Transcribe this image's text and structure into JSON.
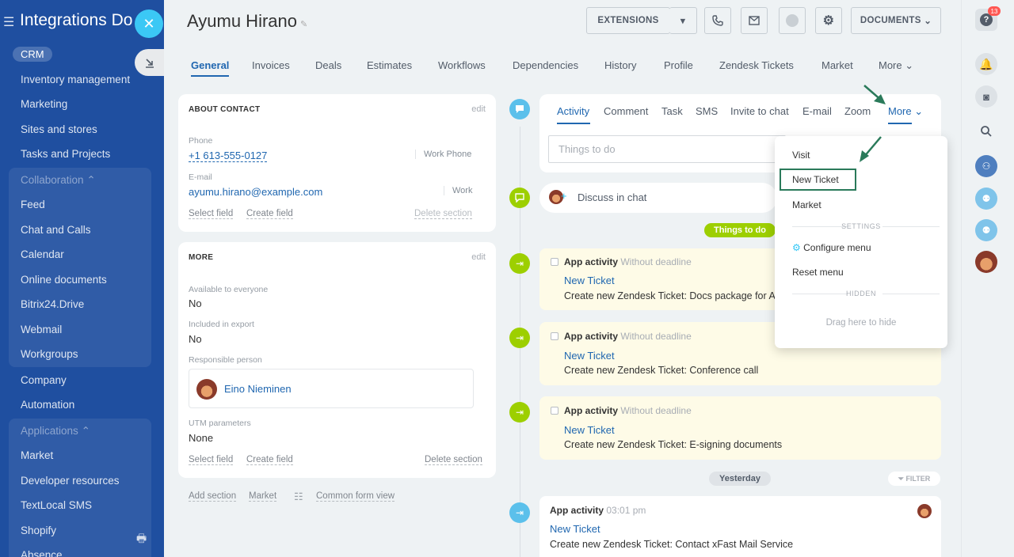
{
  "sidebar": {
    "title": "Integrations Do",
    "crm_label": "CRM",
    "items": [
      "Inventory management",
      "Marketing",
      "Sites and stores",
      "Tasks and Projects"
    ],
    "collaboration_title": "Collaboration",
    "collaboration_items": [
      "Feed",
      "Chat and Calls",
      "Calendar",
      "Online documents",
      "Bitrix24.Drive",
      "Webmail",
      "Workgroups"
    ],
    "mid_items": [
      "Company",
      "Automation"
    ],
    "applications_title": "Applications",
    "applications_items": [
      "Market",
      "Developer resources",
      "TextLocal SMS",
      "Shopify",
      "Absence"
    ],
    "close_icon": "close-icon",
    "collapse_icon": "collapse-icon"
  },
  "header": {
    "contact_name": "Ayumu Hirano",
    "extensions_label": "EXTENSIONS",
    "documents_label": "DOCUMENTS"
  },
  "tabs": [
    "General",
    "Invoices",
    "Deals",
    "Estimates",
    "Workflows",
    "Dependencies",
    "History",
    "Profile",
    "Zendesk Tickets",
    "Market",
    "More"
  ],
  "about_contact": {
    "title": "ABOUT CONTACT",
    "edit": "edit",
    "phone_label": "Phone",
    "phone_value": "+1 613-555-0127",
    "phone_tag": "Work Phone",
    "email_label": "E-mail",
    "email_value": "ayumu.hirano@example.com",
    "email_tag": "Work",
    "select_field": "Select field",
    "create_field": "Create field",
    "delete_section": "Delete section"
  },
  "more_card": {
    "title": "MORE",
    "edit": "edit",
    "available_label": "Available to everyone",
    "available_value": "No",
    "export_label": "Included in export",
    "export_value": "No",
    "responsible_label": "Responsible person",
    "responsible_name": "Eino Nieminen",
    "utm_label": "UTM parameters",
    "utm_value": "None",
    "select_field": "Select field",
    "create_field": "Create field",
    "delete_section": "Delete section"
  },
  "bottom_links": {
    "add_section": "Add section",
    "market": "Market",
    "common_form_view": "Common form view"
  },
  "activity_tabs": [
    "Activity",
    "Comment",
    "Task",
    "SMS",
    "Invite to chat",
    "E-mail",
    "Zoom",
    "More"
  ],
  "activity": {
    "todo_placeholder": "Things to do",
    "discuss_chat": "Discuss in chat",
    "things_to_do_badge": "Things to do",
    "yesterday_badge": "Yesterday",
    "filter_label": "FILTER"
  },
  "todo_items": [
    {
      "title": "App activity",
      "deadline": "Without deadline",
      "link": "New Ticket",
      "text": "Create new Zendesk Ticket: Docs package for A"
    },
    {
      "title": "App activity",
      "deadline": "Without deadline",
      "link": "New Ticket",
      "text": "Create new Zendesk Ticket: Conference call"
    },
    {
      "title": "App activity",
      "deadline": "Without deadline",
      "link": "New Ticket",
      "text": "Create new Zendesk Ticket: E-signing documents"
    }
  ],
  "history_item": {
    "title": "App activity",
    "time": "03:01 pm",
    "link": "New Ticket",
    "text": "Create new Zendesk Ticket: Contact xFast Mail Service"
  },
  "dropdown": {
    "visit": "Visit",
    "new_ticket": "New Ticket",
    "market": "Market",
    "settings_title": "SETTINGS",
    "configure_menu": "Configure menu",
    "reset_menu": "Reset menu",
    "hidden_title": "HIDDEN",
    "drag_hint": "Drag here to hide"
  },
  "right_panel": {
    "help_badge": "13"
  },
  "colors": {
    "sidebar": "#1f4fa0",
    "accent_blue": "#2067b0",
    "green": "#9dcf00",
    "highlight_box": "#2a7a5a"
  }
}
